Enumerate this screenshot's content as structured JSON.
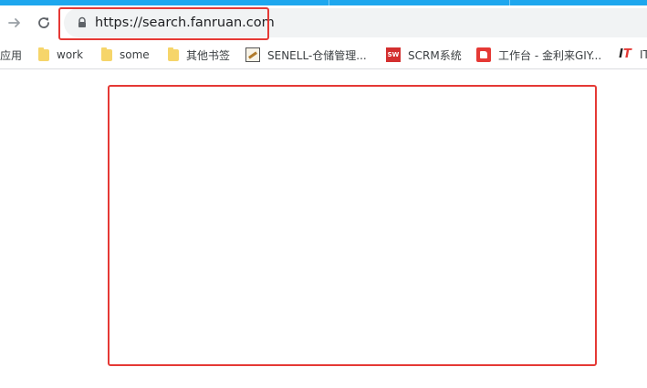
{
  "address_bar": {
    "url": "https://search.fanruan.com"
  },
  "bookmarks": [
    {
      "label": "应用",
      "icon": "apps-icon"
    },
    {
      "label": "work",
      "icon": "folder-icon"
    },
    {
      "label": "some",
      "icon": "folder-icon"
    },
    {
      "label": "其他书签",
      "icon": "folder-icon"
    },
    {
      "label": "SENELL-仓储管理...",
      "icon": "senell-icon"
    },
    {
      "label": "SCRM系统",
      "icon": "scrm-icon",
      "icon_text": "SW"
    },
    {
      "label": "工作台 - 金利来GIY...",
      "icon": "thumb-icon"
    },
    {
      "label": "IT",
      "icon": "it-icon",
      "icon_text": "IT"
    }
  ],
  "colors": {
    "highlight": "#e53935",
    "top_strip": "#1ea7ee",
    "address_bg": "#f1f3f4",
    "folder": "#f6d56a"
  }
}
